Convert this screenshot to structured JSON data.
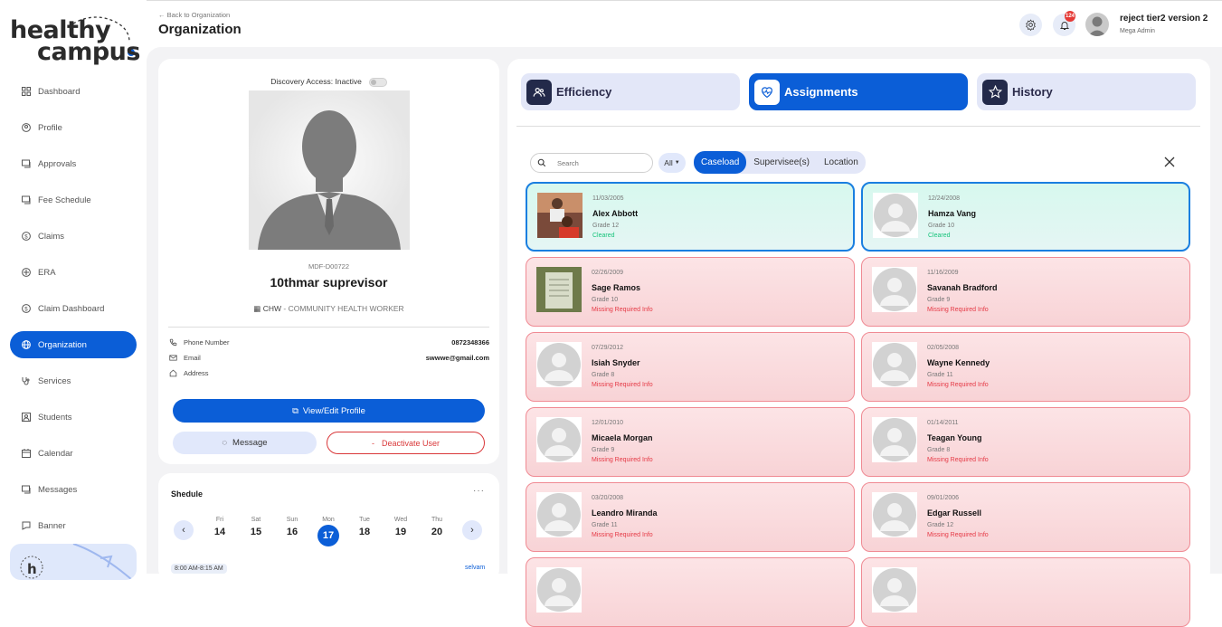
{
  "brand": {
    "line1": "healthy",
    "line2": "campus"
  },
  "sidebar": {
    "items": [
      {
        "label": "Dashboard",
        "icon": "grid-icon",
        "active": false
      },
      {
        "label": "Profile",
        "icon": "user-circle-icon",
        "active": false
      },
      {
        "label": "Approvals",
        "icon": "approvals-icon",
        "active": false
      },
      {
        "label": "Fee Schedule",
        "icon": "fee-schedule-icon",
        "active": false
      },
      {
        "label": "Claims",
        "icon": "dollar-circle-icon",
        "active": false
      },
      {
        "label": "ERA",
        "icon": "era-icon",
        "active": false
      },
      {
        "label": "Claim Dashboard",
        "icon": "dollar-circle-icon",
        "active": false
      },
      {
        "label": "Organization",
        "icon": "globe-icon",
        "active": true
      },
      {
        "label": "Services",
        "icon": "stethoscope-icon",
        "active": false
      },
      {
        "label": "Students",
        "icon": "students-icon",
        "active": false
      },
      {
        "label": "Calendar",
        "icon": "calendar-icon",
        "active": false
      },
      {
        "label": "Messages",
        "icon": "messages-icon",
        "active": false
      },
      {
        "label": "Banner",
        "icon": "banner-icon",
        "active": false
      }
    ]
  },
  "header": {
    "back_label": "Back to Organization",
    "title": "Organization",
    "notification_count": "124",
    "user_name": "reject tier2 version 2",
    "user_role": "Mega Admin"
  },
  "profile": {
    "discovery_label": "Discovery Access: Inactive",
    "discovery_on": false,
    "id": "MDF-D00722",
    "name": "10thmar suprevisor",
    "role_code": "CHW",
    "role_sep": " - ",
    "role_desc": "COMMUNITY HEALTH WORKER",
    "phone_label": "Phone Number",
    "phone": "0872348366",
    "email_label": "Email",
    "email": "swwwe@gmail.com",
    "address_label": "Address",
    "address": "",
    "view_edit_label": "View/Edit Profile",
    "message_label": "Message",
    "deactivate_label": "Deactivate User"
  },
  "schedule": {
    "title": "Shedule",
    "more": "···",
    "days": [
      {
        "name": "Fri",
        "date": "14",
        "selected": false
      },
      {
        "name": "Sat",
        "date": "15",
        "selected": false
      },
      {
        "name": "Sun",
        "date": "16",
        "selected": false
      },
      {
        "name": "Mon",
        "date": "17",
        "selected": true
      },
      {
        "name": "Tue",
        "date": "18",
        "selected": false
      },
      {
        "name": "Wed",
        "date": "19",
        "selected": false
      },
      {
        "name": "Thu",
        "date": "20",
        "selected": false
      }
    ],
    "event_time": "8:00 AM-8:15 AM",
    "event_who": "selvam"
  },
  "tabs": [
    {
      "label": "Efficiency",
      "icon": "users-icon",
      "active": false
    },
    {
      "label": "Assignments",
      "icon": "heart-pulse-icon",
      "active": true
    },
    {
      "label": "History",
      "icon": "star-icon",
      "active": false
    }
  ],
  "filters": {
    "search_placeholder": "Search",
    "all_label": "All",
    "segments": [
      "Caseload",
      "Supervisee(s)",
      "Location"
    ],
    "active_segment": "Caseload"
  },
  "students": [
    {
      "dob": "11/03/2005",
      "name": "Alex Abbott",
      "grade": "Grade 12",
      "status": "Cleared",
      "cleared": true,
      "photo": "photo1"
    },
    {
      "dob": "12/24/2008",
      "name": "Hamza Vang",
      "grade": "Grade 10",
      "status": "Cleared",
      "cleared": true,
      "photo": "default"
    },
    {
      "dob": "02/26/2009",
      "name": "Sage Ramos",
      "grade": "Grade 10",
      "status": "Missing Required Info",
      "cleared": false,
      "photo": "photo2"
    },
    {
      "dob": "11/16/2009",
      "name": "Savanah Bradford",
      "grade": "Grade 9",
      "status": "Missing Required Info",
      "cleared": false,
      "photo": "default"
    },
    {
      "dob": "07/29/2012",
      "name": "Isiah Snyder",
      "grade": "Grade 8",
      "status": "Missing Required Info",
      "cleared": false,
      "photo": "default"
    },
    {
      "dob": "02/05/2008",
      "name": "Wayne Kennedy",
      "grade": "Grade 11",
      "status": "Missing Required Info",
      "cleared": false,
      "photo": "default"
    },
    {
      "dob": "12/01/2010",
      "name": "Micaela Morgan",
      "grade": "Grade 9",
      "status": "Missing Required Info",
      "cleared": false,
      "photo": "default"
    },
    {
      "dob": "01/14/2011",
      "name": "Teagan Young",
      "grade": "Grade 8",
      "status": "Missing Required Info",
      "cleared": false,
      "photo": "default"
    },
    {
      "dob": "03/20/2008",
      "name": "Leandro Miranda",
      "grade": "Grade 11",
      "status": "Missing Required Info",
      "cleared": false,
      "photo": "default"
    },
    {
      "dob": "09/01/2006",
      "name": "Edgar Russell",
      "grade": "Grade 12",
      "status": "Missing Required Info",
      "cleared": false,
      "photo": "default"
    },
    {
      "dob": "",
      "name": "",
      "grade": "",
      "status": "",
      "cleared": false,
      "photo": "default"
    },
    {
      "dob": "",
      "name": "",
      "grade": "",
      "status": "",
      "cleared": false,
      "photo": "default"
    }
  ],
  "colors": {
    "accent": "#0b5ed7",
    "cleared_text": "#17c37b",
    "missing_text": "#e53945",
    "danger": "#d9383a"
  }
}
